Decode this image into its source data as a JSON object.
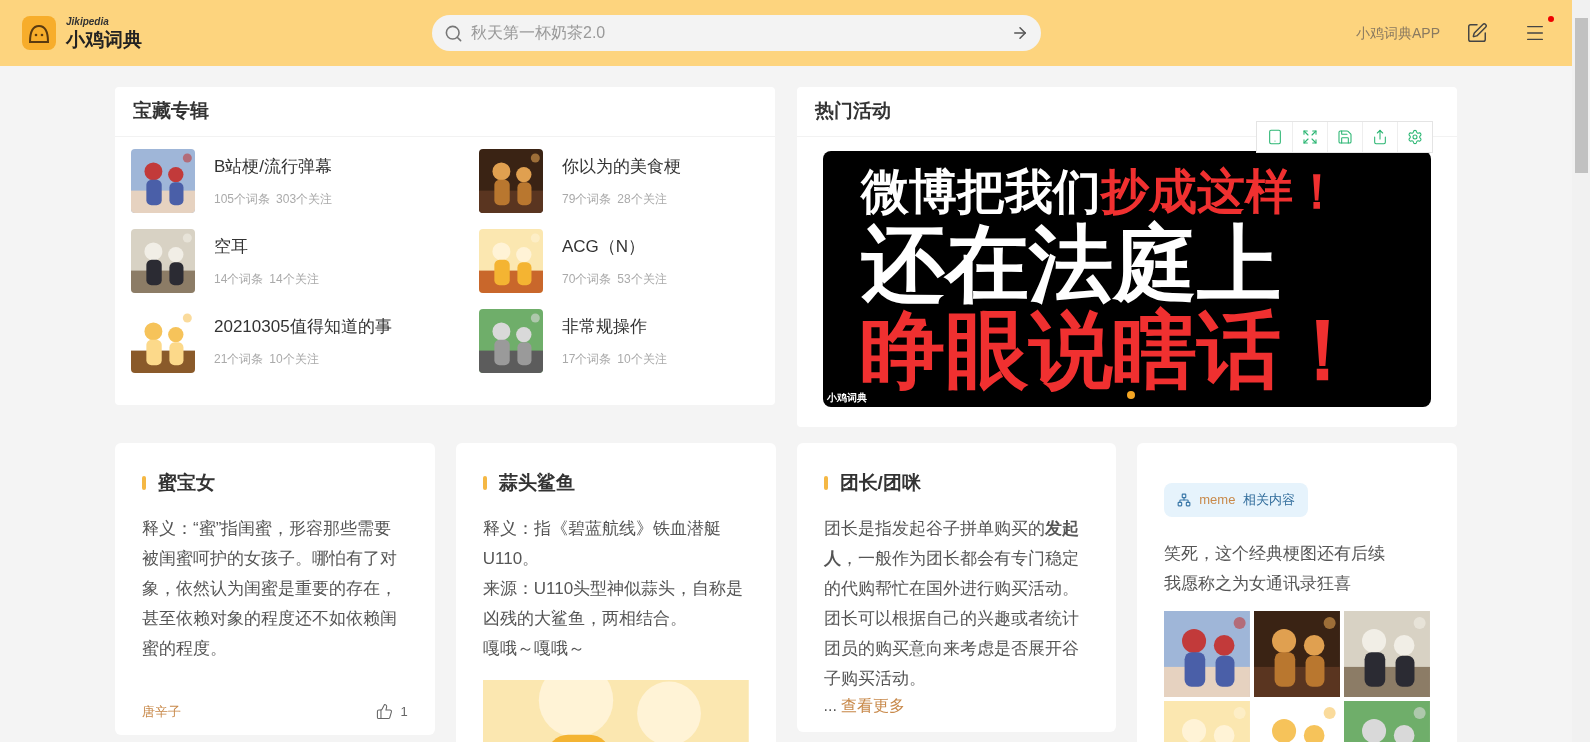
{
  "header": {
    "logo_small": "Jikipedia",
    "logo": "小鸡词典",
    "search": {
      "placeholder": "秋天第一杯奶茶2.0"
    },
    "app_link": "小鸡词典APP",
    "menu_badge": true
  },
  "collections": {
    "title": "宝藏专辑",
    "items": [
      {
        "name": "B站梗/流行弹幕",
        "entries": "105个词条",
        "followers": "303个关注"
      },
      {
        "name": "你以为的美食梗",
        "entries": "79个词条",
        "followers": "28个关注"
      },
      {
        "name": "空耳",
        "entries": "14个词条",
        "followers": "14个关注"
      },
      {
        "name": "ACG（N）",
        "entries": "70个词条",
        "followers": "53个关注"
      },
      {
        "name": "20210305值得知道的事",
        "entries": "21个词条",
        "followers": "10个关注"
      },
      {
        "name": "非常规操作",
        "entries": "17个词条",
        "followers": "10个关注"
      }
    ]
  },
  "events": {
    "title": "热门活动",
    "banner": {
      "lines": [
        [
          {
            "text": "微博把我们",
            "color": "#ffffff"
          },
          {
            "text": "抄成这样！",
            "color": "#f03030"
          }
        ],
        [
          {
            "text": "还在法庭上",
            "color": "#ffffff"
          }
        ],
        [
          {
            "text": "睁眼说瞎话！",
            "color": "#f03030"
          }
        ]
      ],
      "corner": "小鸡词典",
      "dots": [
        {
          "selected": true
        }
      ]
    }
  },
  "cards": [
    {
      "kind": "definition",
      "title": "蜜宝女",
      "paragraphs": [
        "释义：“蜜”指闺蜜，形容那些需要被闺蜜呵护的女孩子。哪怕有了对象，依然认为闺蜜是重要的存在，甚至依赖对象的程度还不如依赖闺蜜的程度。"
      ],
      "author": "唐辛子",
      "likes": "1"
    },
    {
      "kind": "definition",
      "title": "蒜头鲨鱼",
      "paragraphs": [
        "释义：指《碧蓝航线》铁血潜艇U110。",
        "来源：U110头型神似蒜头，自称是凶残的大鲨鱼，两相结合。",
        "嘎哦～嘎哦～"
      ],
      "picture": true
    },
    {
      "kind": "definition",
      "title": "团长/团咪",
      "paragraphs": [
        "团长是指发起谷子拼单购买的**发起人**，一般作为团长都会有专门稳定的代购帮忙在国外进行购买活动。团长可以根据自己的兴趣或者统计团员的购买意向来考虑是否展开谷子购买活动。"
      ],
      "ellipsis": "...",
      "more": "查看更多"
    },
    {
      "kind": "post",
      "tag": {
        "topic": "meme",
        "label": "相关内容"
      },
      "paragraphs": [
        "笑死，这个经典梗图还有后续",
        "我愿称之为女通讯录狂喜"
      ]
    }
  ]
}
